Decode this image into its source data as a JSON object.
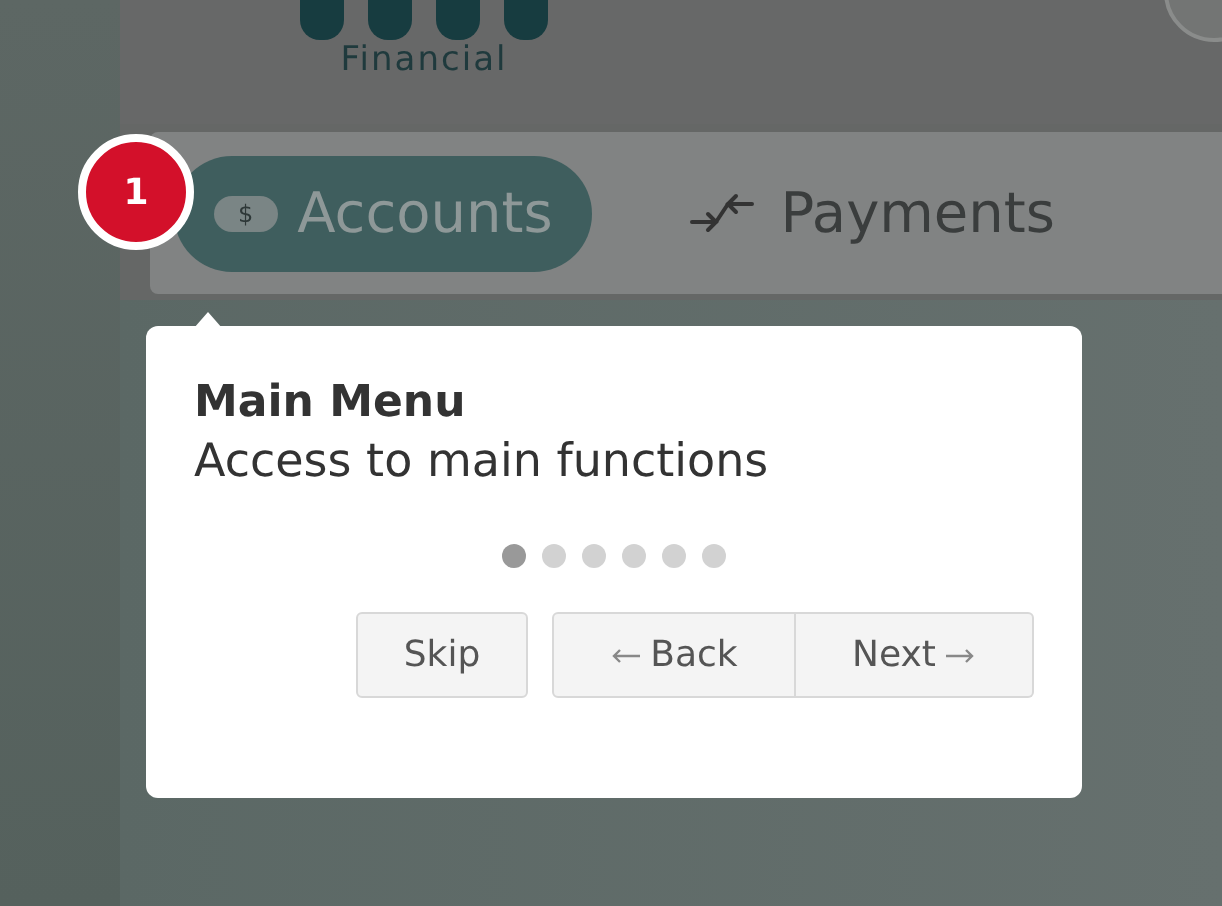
{
  "logo": {
    "text": "Financial"
  },
  "nav": [
    {
      "label": "Accounts",
      "selected": true,
      "kind": "dollar",
      "badge": "$"
    },
    {
      "label": "Payments",
      "selected": false,
      "kind": "transfer"
    }
  ],
  "tour": {
    "step_badge": "1",
    "title": "Main Menu",
    "text": "Access to main functions",
    "steps": [
      {
        "selected": true
      },
      {
        "selected": false
      },
      {
        "selected": false
      },
      {
        "selected": false
      },
      {
        "selected": false
      },
      {
        "selected": false
      }
    ],
    "buttons": [
      {
        "label": "Skip",
        "kind": "skip"
      },
      {
        "label": "Back",
        "kind": "back"
      },
      {
        "label": "Next",
        "kind": "next"
      }
    ]
  }
}
